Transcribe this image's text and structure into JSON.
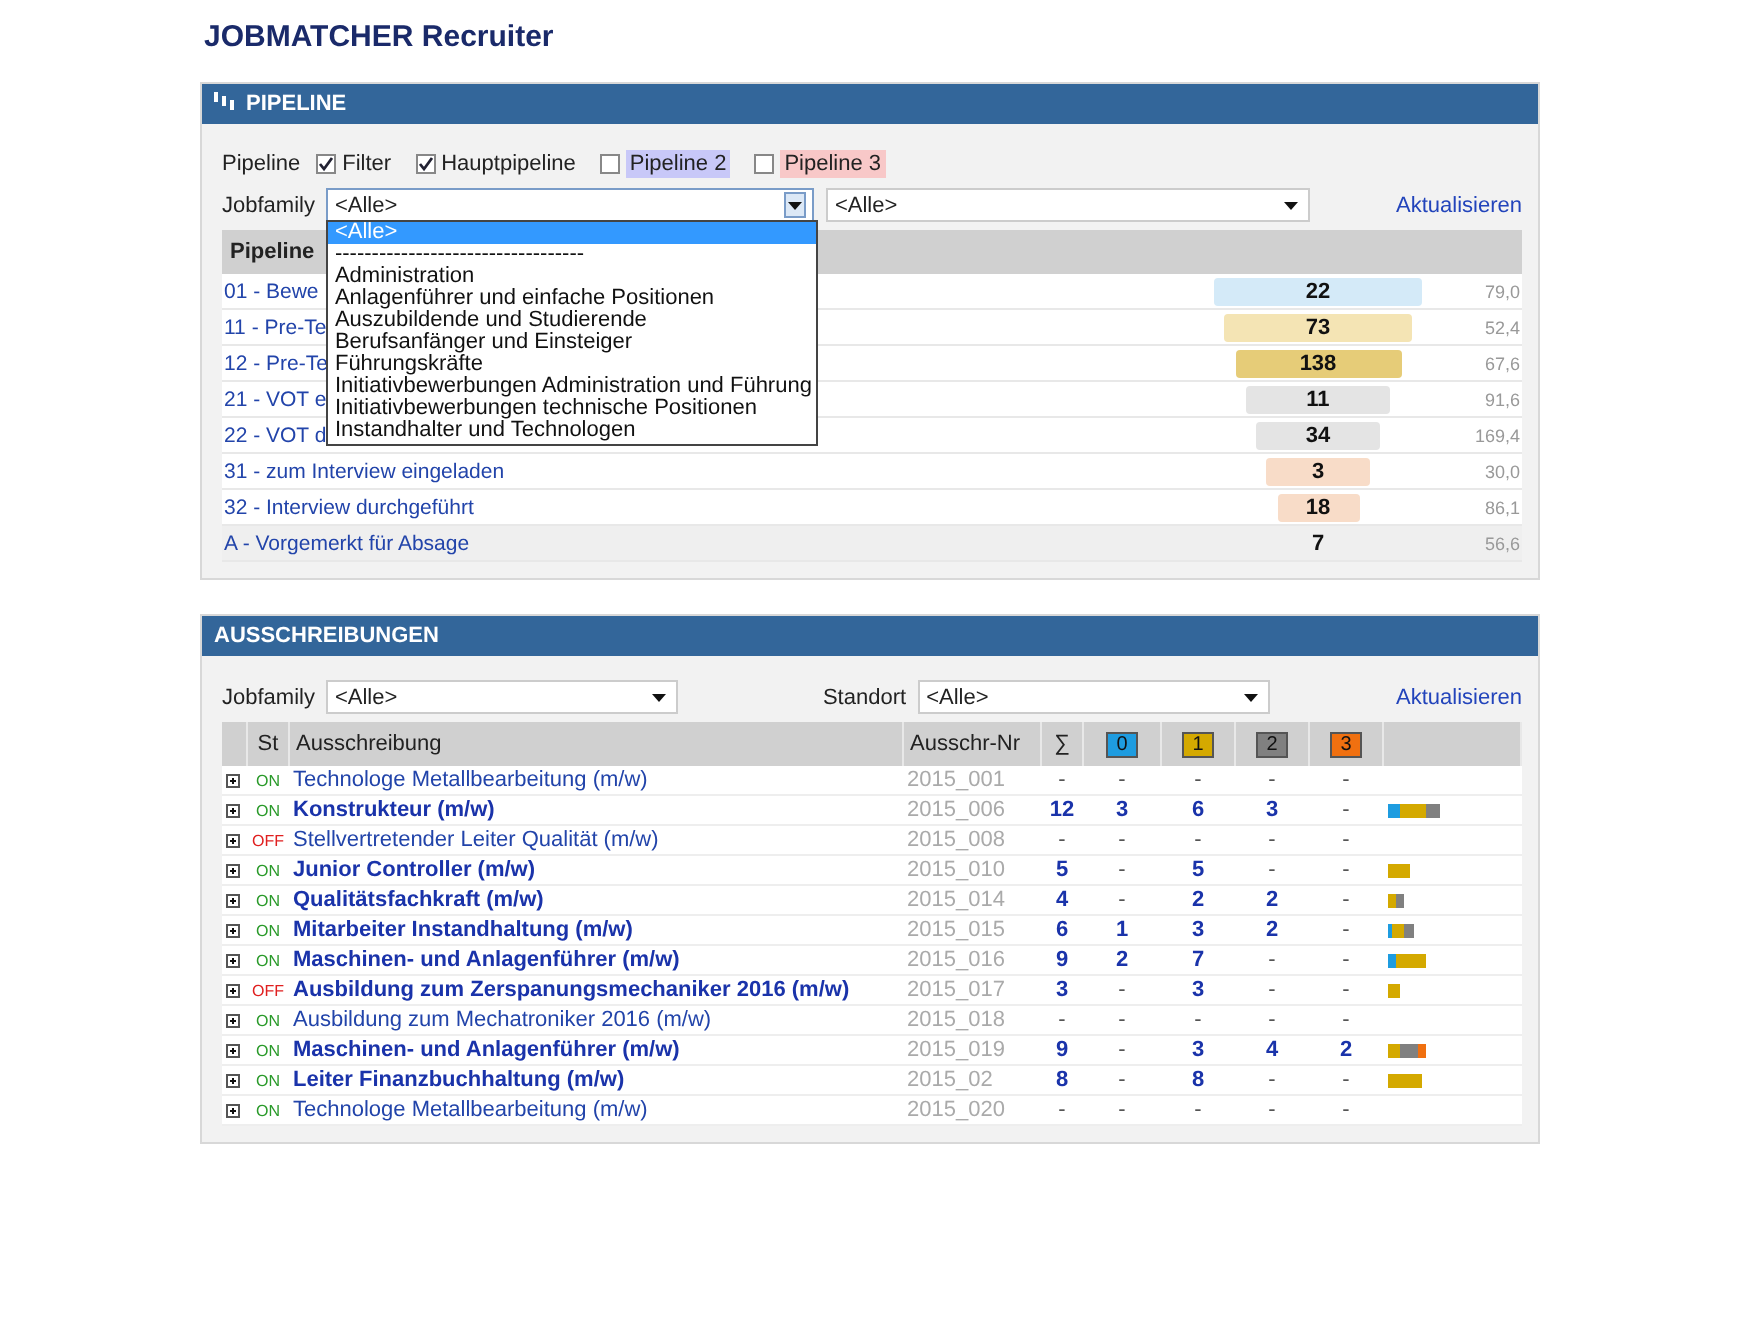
{
  "app_title": "JOBMATCHER Recruiter",
  "pipeline_panel": {
    "title": "PIPELINE",
    "pipeline_label": "Pipeline",
    "checkboxes": [
      {
        "label": "Filter",
        "checked": true
      },
      {
        "label": "Hauptpipeline",
        "checked": true
      },
      {
        "label": "Pipeline 2",
        "checked": false,
        "color": "#c8c8f8"
      },
      {
        "label": "Pipeline 3",
        "checked": false,
        "color": "#f8c8c8"
      }
    ],
    "jobfamily_label": "Jobfamily",
    "jobfamily_select": {
      "value": "<Alle>",
      "expanded": true,
      "options": [
        {
          "label": "<Alle>",
          "selected": true
        },
        {
          "label": "----------------------------------",
          "selected": false
        },
        {
          "label": "Administration",
          "selected": false
        },
        {
          "label": "Anlagenführer und einfache Positionen",
          "selected": false
        },
        {
          "label": "Auszubildende und Studierende",
          "selected": false
        },
        {
          "label": "Berufsanfänger und Einsteiger",
          "selected": false
        },
        {
          "label": "Führungskräfte",
          "selected": false
        },
        {
          "label": "Initiativbewerbungen Administration und Führung",
          "selected": false
        },
        {
          "label": "Initiativbewerbungen technische Positionen",
          "selected": false
        },
        {
          "label": "Instandhalter und Technologen",
          "selected": false
        }
      ]
    },
    "second_select": {
      "value": "<Alle>"
    },
    "refresh_link": "Aktualisieren",
    "table": {
      "columns": [
        "Pipeline"
      ],
      "rows": [
        {
          "label": "01 - Bewe",
          "count": "22",
          "color": "#d4eaf8",
          "avg": "79,0",
          "highlighted": false
        },
        {
          "label": "11 - Pre-Te",
          "count": "73",
          "color": "#f4e4b4",
          "avg": "52,4",
          "highlighted": false
        },
        {
          "label": "12 - Pre-Te",
          "count": "138",
          "color": "#e6cc78",
          "avg": "67,6",
          "highlighted": false
        },
        {
          "label": "21 - VOT e",
          "count": "11",
          "color": "#e4e4e4",
          "avg": "91,6",
          "highlighted": false
        },
        {
          "label": "22 - VOT d",
          "count": "34",
          "color": "#e4e4e4",
          "avg": "169,4",
          "highlighted": false
        },
        {
          "label": "31 - zum Interview eingeladen",
          "count": "3",
          "color": "#f8dcc8",
          "avg": "30,0",
          "highlighted": false
        },
        {
          "label": "32 - Interview durchgeführt",
          "count": "18",
          "color": "#f8dcc8",
          "avg": "86,1",
          "highlighted": false
        },
        {
          "label": "A - Vorgemerkt für Absage",
          "count": "7",
          "avg": "56,6",
          "highlighted": true
        }
      ]
    }
  },
  "postings_panel": {
    "title": "AUSSCHREIBUNGEN",
    "jobfamily_label": "Jobfamily",
    "jobfamily_select": {
      "value": "<Alle>"
    },
    "location_label": "Standort",
    "location_select": {
      "value": "<Alle>"
    },
    "refresh_link": "Aktualisieren",
    "columns": [
      {
        "label": "St"
      },
      {
        "label": "Ausschreibung"
      },
      {
        "label": "Ausschr-Nr"
      },
      {
        "label": "∑"
      },
      {
        "label": "0",
        "color": "#1e9ce0"
      },
      {
        "label": "1",
        "color": "#d4a900"
      },
      {
        "label": "2",
        "color": "#808080"
      },
      {
        "label": "3",
        "color": "#f07010"
      }
    ],
    "rows": [
      {
        "on": true,
        "status": "ON",
        "title": "Technologe Metallbearbeitung (m/w)",
        "bold": false,
        "number": "2015_001",
        "sum": "-",
        "stages": [
          "-",
          "-",
          "-",
          "-"
        ]
      },
      {
        "on": true,
        "status": "ON",
        "title": "Konstrukteur (m/w)",
        "bold": true,
        "number": "2015_006",
        "sum": "12",
        "stages": [
          "3",
          "6",
          "3",
          "-"
        ]
      },
      {
        "on": false,
        "status": "OFF",
        "title": "Stellvertretender Leiter Qualität (m/w)",
        "bold": false,
        "number": "2015_008",
        "sum": "-",
        "stages": [
          "-",
          "-",
          "-",
          "-"
        ]
      },
      {
        "on": true,
        "status": "ON",
        "title": "Junior Controller (m/w)",
        "bold": true,
        "number": "2015_010",
        "sum": "5",
        "stages": [
          "-",
          "5",
          "-",
          "-"
        ]
      },
      {
        "on": true,
        "status": "ON",
        "title": "Qualitätsfachkraft (m/w)",
        "bold": true,
        "number": "2015_014",
        "sum": "4",
        "stages": [
          "-",
          "2",
          "2",
          "-"
        ]
      },
      {
        "on": true,
        "status": "ON",
        "title": "Mitarbeiter Instandhaltung (m/w)",
        "bold": true,
        "number": "2015_015",
        "sum": "6",
        "stages": [
          "1",
          "3",
          "2",
          "-"
        ]
      },
      {
        "on": true,
        "status": "ON",
        "title": "Maschinen- und Anlagenführer (m/w)",
        "bold": true,
        "number": "2015_016",
        "sum": "9",
        "stages": [
          "2",
          "7",
          "-",
          "-"
        ]
      },
      {
        "on": false,
        "status": "OFF",
        "title": "Ausbildung zum Zerspanungsmechaniker 2016 (m/w)",
        "bold": true,
        "number": "2015_017",
        "sum": "3",
        "stages": [
          "-",
          "3",
          "-",
          "-"
        ]
      },
      {
        "on": true,
        "status": "ON",
        "title": "Ausbildung zum Mechatroniker 2016 (m/w)",
        "bold": false,
        "number": "2015_018",
        "sum": "-",
        "stages": [
          "-",
          "-",
          "-",
          "-"
        ]
      },
      {
        "on": true,
        "status": "ON",
        "title": "Maschinen- und Anlagenführer (m/w)",
        "bold": true,
        "number": "2015_019",
        "sum": "9",
        "stages": [
          "-",
          "3",
          "4",
          "2"
        ]
      },
      {
        "on": true,
        "status": "ON",
        "title": "Leiter Finanzbuchhaltung (m/w)",
        "bold": true,
        "number": "2015_02",
        "sum": "8",
        "stages": [
          "-",
          "8",
          "-",
          "-"
        ]
      },
      {
        "on": true,
        "status": "ON",
        "title": "Technologe Metallbearbeitung (m/w)",
        "bold": false,
        "number": "2015_020",
        "sum": "-",
        "stages": [
          "-",
          "-",
          "-",
          "-"
        ]
      }
    ]
  }
}
